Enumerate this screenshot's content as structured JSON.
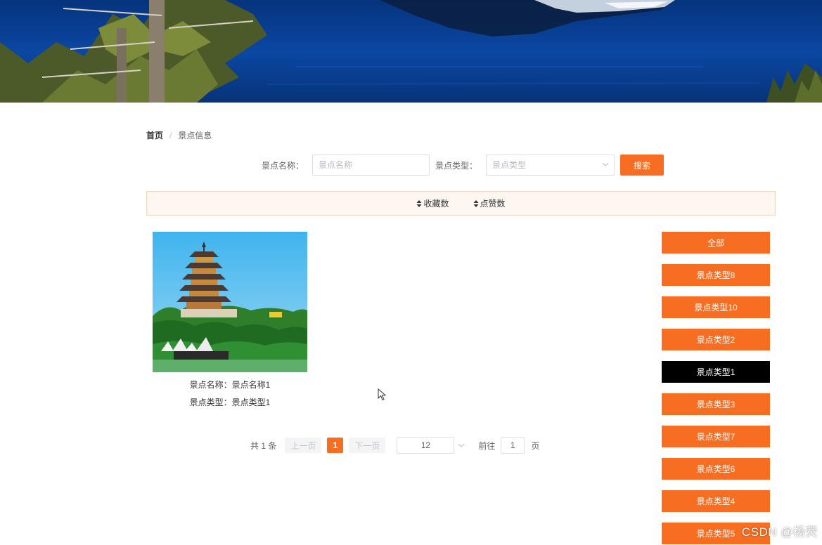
{
  "breadcrumb": {
    "home": "首页",
    "separator": "/",
    "current": "景点信息"
  },
  "search": {
    "name_label": "景点名称：",
    "name_placeholder": "景点名称",
    "name_value": "",
    "type_label": "景点类型：",
    "type_placeholder": "景点类型",
    "button": "搜索"
  },
  "sort": [
    {
      "label": "收藏数",
      "icon": "sort-icon"
    },
    {
      "label": "点赞数",
      "icon": "sort-icon"
    }
  ],
  "items": [
    {
      "image": "pagoda-photo",
      "name_line": "景点名称：景点名称1",
      "type_line": "景点类型：景点类型1"
    }
  ],
  "pagination": {
    "total": "共 1 条",
    "prev": "上一页",
    "current_page": "1",
    "next": "下一页",
    "page_size": "12",
    "goto": "前往",
    "jump_value": "1",
    "page_unit": "页"
  },
  "categories": [
    {
      "label": "全部",
      "active": false
    },
    {
      "label": "景点类型8",
      "active": false
    },
    {
      "label": "景点类型10",
      "active": false
    },
    {
      "label": "景点类型2",
      "active": false
    },
    {
      "label": "景点类型1",
      "active": true
    },
    {
      "label": "景点类型3",
      "active": false
    },
    {
      "label": "景点类型7",
      "active": false
    },
    {
      "label": "景点类型6",
      "active": false
    },
    {
      "label": "景点类型4",
      "active": false
    },
    {
      "label": "景点类型5",
      "active": false
    }
  ],
  "watermark": "CSDN @杨荧",
  "colors": {
    "accent": "#f76e22",
    "active_category": "#000000",
    "sortbar_bg": "#fdf6f1"
  }
}
